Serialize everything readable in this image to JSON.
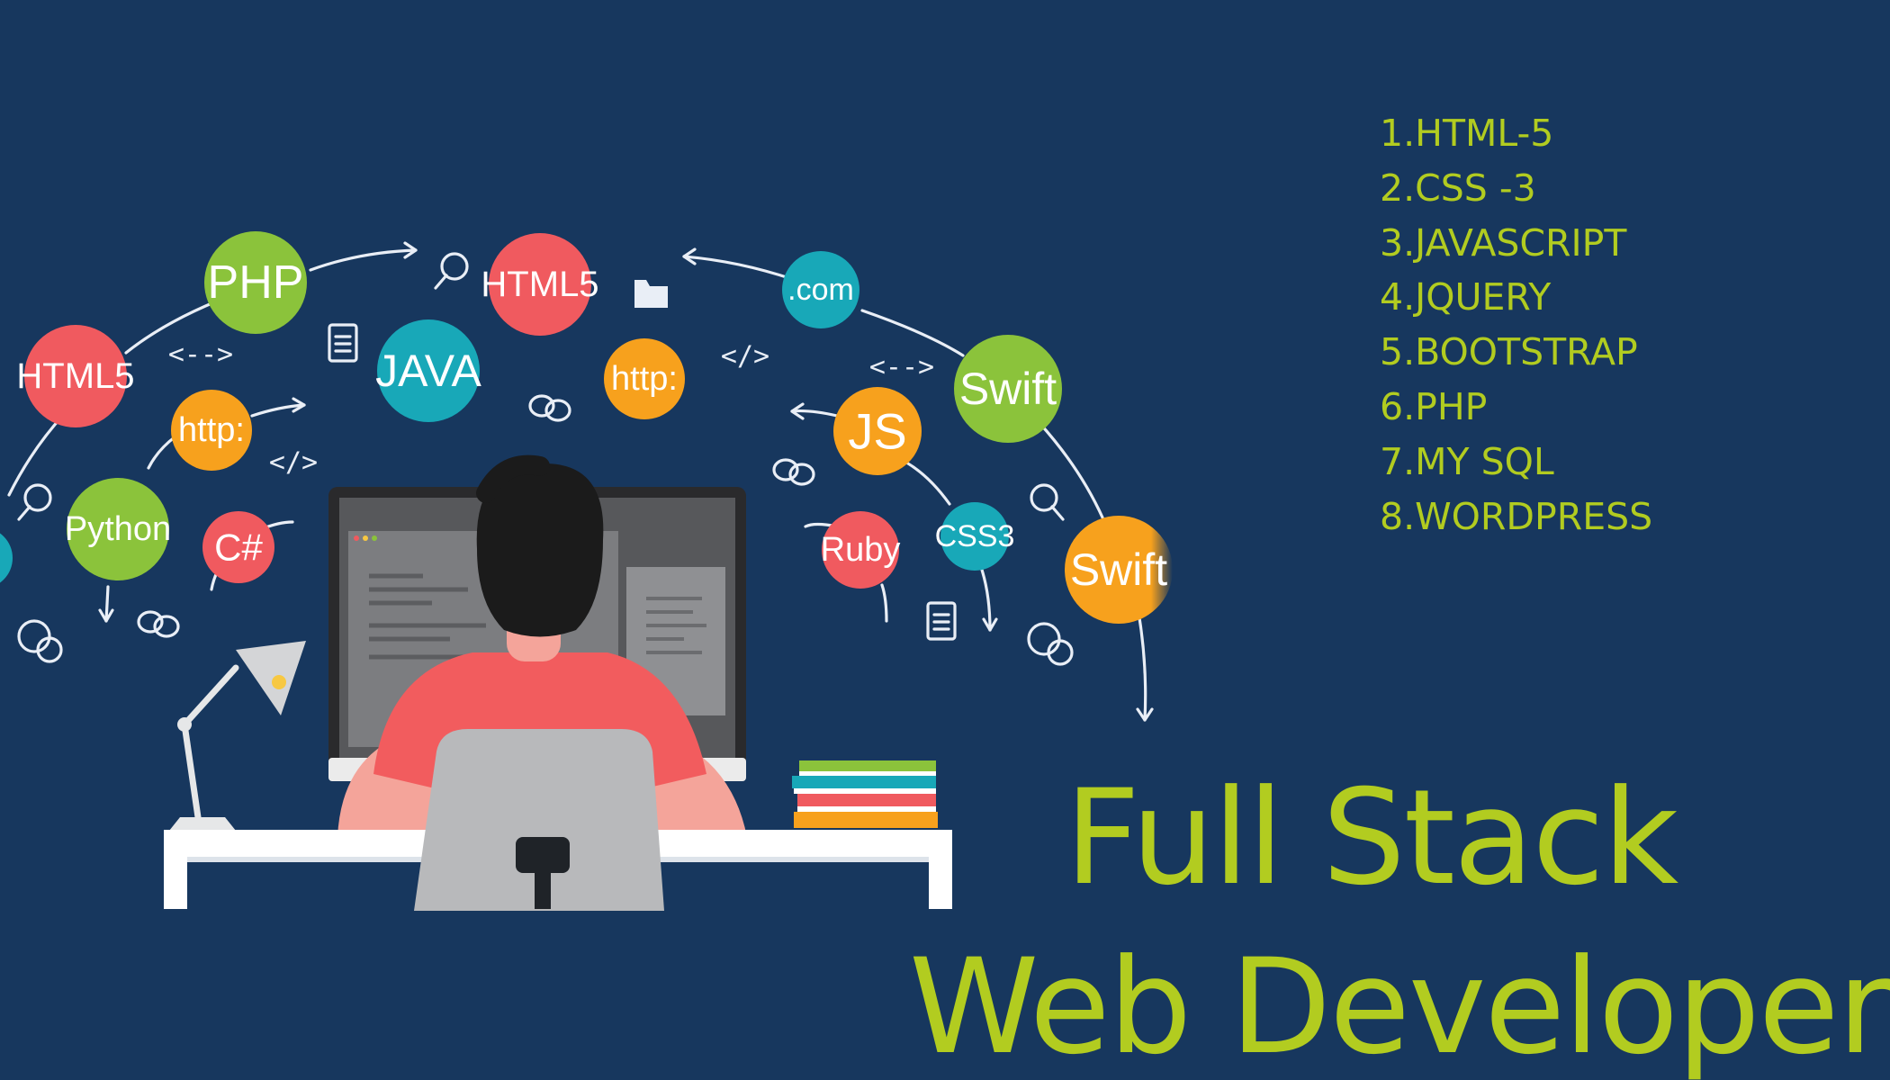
{
  "skills": [
    "1.HTML-5",
    "2.CSS -3",
    "3.JAVASCRIPT",
    "4.JQUERY",
    "5.BOOTSTRAP",
    "6.PHP",
    "7.MY SQL",
    "8.WORDPRESS"
  ],
  "title": {
    "line1": "Full Stack",
    "line2": "Web Developer"
  },
  "bubbles": {
    "php": "PHP",
    "html5_left": "HTML5",
    "html5_top": "HTML5",
    "java": "JAVA",
    "http_left": "http:",
    "http_mid": "http:",
    "python": "Python",
    "csharp": "C#",
    "dotcom": ".com",
    "js": "JS",
    "swift_upper": "Swift",
    "swift_lower": "Swift",
    "ruby": "Ruby",
    "css3": "CSS3"
  },
  "symbols": {
    "arrows": "<-->",
    "tag": "</>"
  },
  "colors": {
    "background": "#17375e",
    "accent_text": "#b2cc20",
    "green": "#8bc33b",
    "red": "#f05a5f",
    "teal": "#18a8b8",
    "orange": "#f7a11d",
    "shirt": "#f25c5e",
    "chair": "#b8b9bb",
    "desk": "#ffffff"
  }
}
